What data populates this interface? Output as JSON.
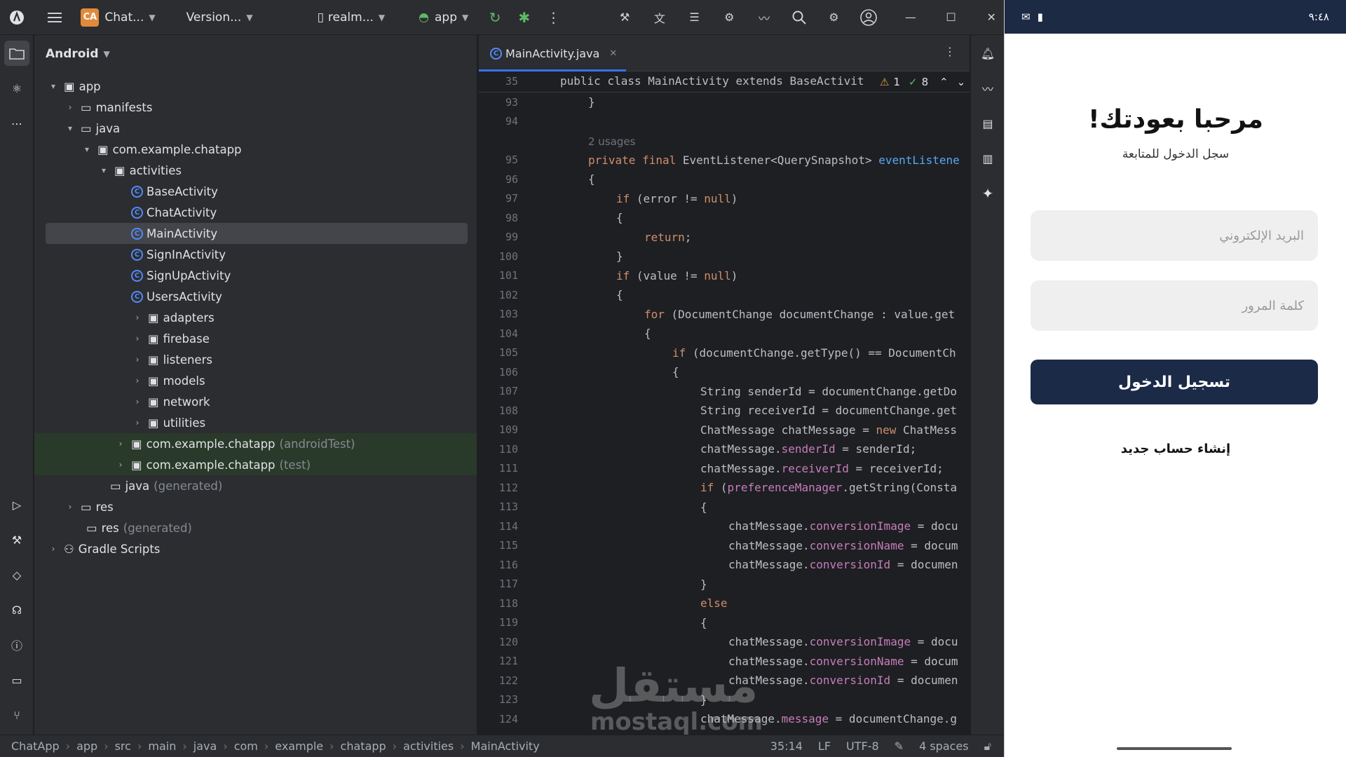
{
  "topbar": {
    "project_badge": "CA",
    "project_name": "Chat...",
    "version_menu": "Version...",
    "device": "realm...",
    "run_config": "app"
  },
  "project_panel": {
    "view_mode": "Android",
    "tree": [
      {
        "label": "app",
        "extra": ""
      },
      {
        "label": "manifests",
        "extra": ""
      },
      {
        "label": "java",
        "extra": ""
      },
      {
        "label": "com.example.chatapp",
        "extra": ""
      },
      {
        "label": "activities",
        "extra": ""
      },
      {
        "label": "BaseActivity",
        "extra": ""
      },
      {
        "label": "ChatActivity",
        "extra": ""
      },
      {
        "label": "MainActivity",
        "extra": ""
      },
      {
        "label": "SignInActivity",
        "extra": ""
      },
      {
        "label": "SignUpActivity",
        "extra": ""
      },
      {
        "label": "UsersActivity",
        "extra": ""
      },
      {
        "label": "adapters",
        "extra": ""
      },
      {
        "label": "firebase",
        "extra": ""
      },
      {
        "label": "listeners",
        "extra": ""
      },
      {
        "label": "models",
        "extra": ""
      },
      {
        "label": "network",
        "extra": ""
      },
      {
        "label": "utilities",
        "extra": ""
      },
      {
        "label": "com.example.chatapp",
        "extra": "(androidTest)"
      },
      {
        "label": "com.example.chatapp",
        "extra": "(test)"
      },
      {
        "label": "java",
        "extra": "(generated)"
      },
      {
        "label": "res",
        "extra": ""
      },
      {
        "label": "res",
        "extra": "(generated)"
      },
      {
        "label": "Gradle Scripts",
        "extra": ""
      }
    ]
  },
  "editor": {
    "tab": "MainActivity.java",
    "warnings": "1",
    "checks": "8",
    "sticky_line": "35",
    "sticky_code": "public class MainActivity extends BaseActivit",
    "usages_hint": "2 usages",
    "line_numbers": [
      "93",
      "94",
      "95",
      "96",
      "97",
      "98",
      "99",
      "100",
      "101",
      "102",
      "103",
      "104",
      "105",
      "106",
      "107",
      "108",
      "109",
      "110",
      "111",
      "112",
      "113",
      "114",
      "115",
      "116",
      "117",
      "118",
      "119",
      "120",
      "121",
      "122",
      "123",
      "124"
    ]
  },
  "statusbar": {
    "crumbs": [
      "ChatApp",
      "app",
      "src",
      "main",
      "java",
      "com",
      "example",
      "chatapp",
      "activities",
      "MainActivity"
    ],
    "position": "35:14",
    "line_sep": "LF",
    "encoding": "UTF-8",
    "indent": "4 spaces"
  },
  "phone": {
    "time": "٩:٤٨",
    "title": "مرحبا بعودتك!",
    "subtitle": "سجل الدخول للمتابعة",
    "email_placeholder": "البريد الإلكتروني",
    "password_placeholder": "كلمة المرور",
    "login_button": "تسجيل الدخول",
    "signup_link": "إنشاء حساب جديد"
  },
  "watermark": {
    "text": "مستقل",
    "domain": "mostaql.com"
  },
  "colors": {
    "accent": "#3574f0",
    "phone_button": "#1b2a47",
    "ide_bg": "#1e1f22"
  }
}
